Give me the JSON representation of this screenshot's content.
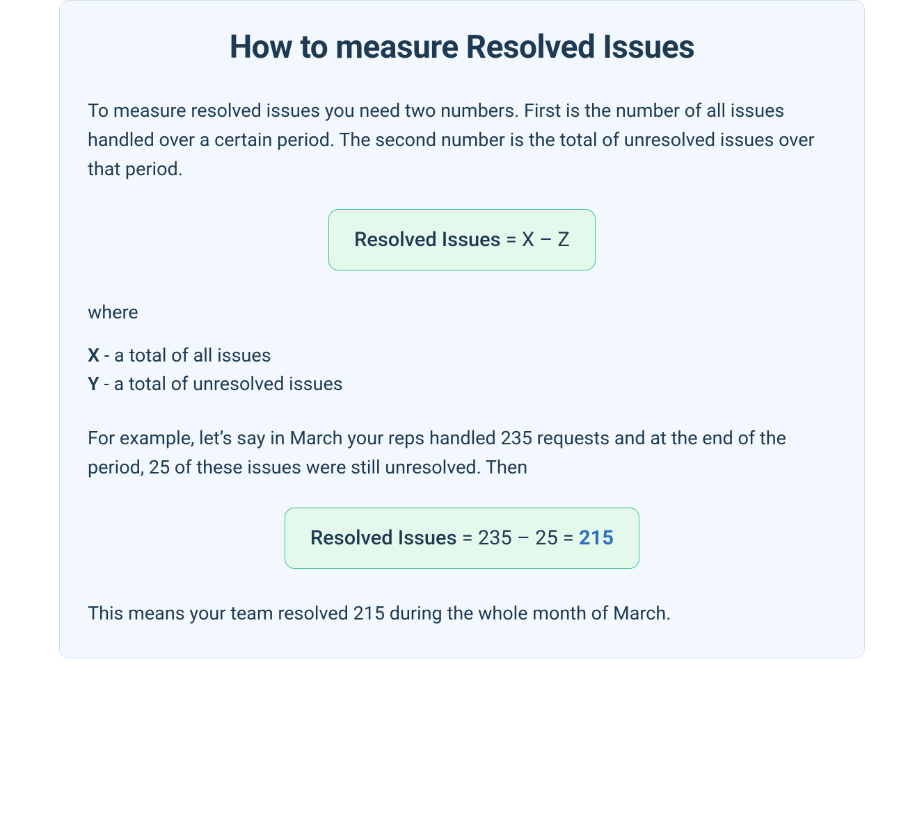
{
  "title": "How to measure Resolved Issues",
  "intro": "To measure resolved issues you need two numbers. First is the number of all issues handled over a certain period. The second number is the total of unresolved issues over that period.",
  "formula1": {
    "lhs": "Resolved Issues",
    "eq": " = ",
    "rhs": "X – Z"
  },
  "where_label": "where",
  "definitions": {
    "x_var": "X",
    "x_desc": " - a total of all issues",
    "y_var": "Y",
    "y_desc": " - a total of unresolved issues"
  },
  "example_intro": "For example, let’s say in March your reps handled 235 requests and at the end of the period, 25 of these issues were still unresolved. Then",
  "formula2": {
    "lhs": "Resolved Issues",
    "eq": " = ",
    "mid": "235 – 25 = ",
    "result": "215"
  },
  "conclusion": "This means your team resolved 215 during the whole month of March."
}
